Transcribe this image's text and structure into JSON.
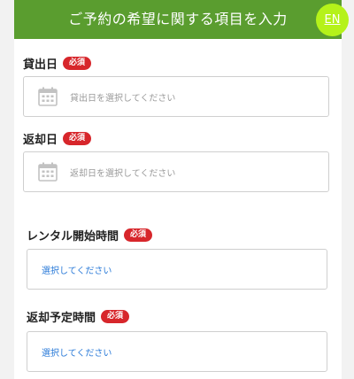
{
  "header": {
    "title": "ご予約の希望に関する項目を入力",
    "lang_toggle": "EN"
  },
  "colors": {
    "header_bg": "#5a9d2f",
    "lang_toggle_bg": "#b5f21a",
    "required_badge": "#d7262b",
    "select_text": "#2a7ad8"
  },
  "fields": {
    "rental_date": {
      "label": "貸出日",
      "badge": "必須",
      "placeholder": "貸出日を選択してください",
      "icon": "calendar-icon"
    },
    "return_date": {
      "label": "返却日",
      "badge": "必須",
      "placeholder": "返却日を選択してください",
      "icon": "calendar-icon"
    },
    "rental_start_time": {
      "label": "レンタル開始時間",
      "badge": "必須",
      "value": "選択してください"
    },
    "return_time": {
      "label": "返却予定時間",
      "badge": "必須",
      "value": "選択してください"
    }
  }
}
